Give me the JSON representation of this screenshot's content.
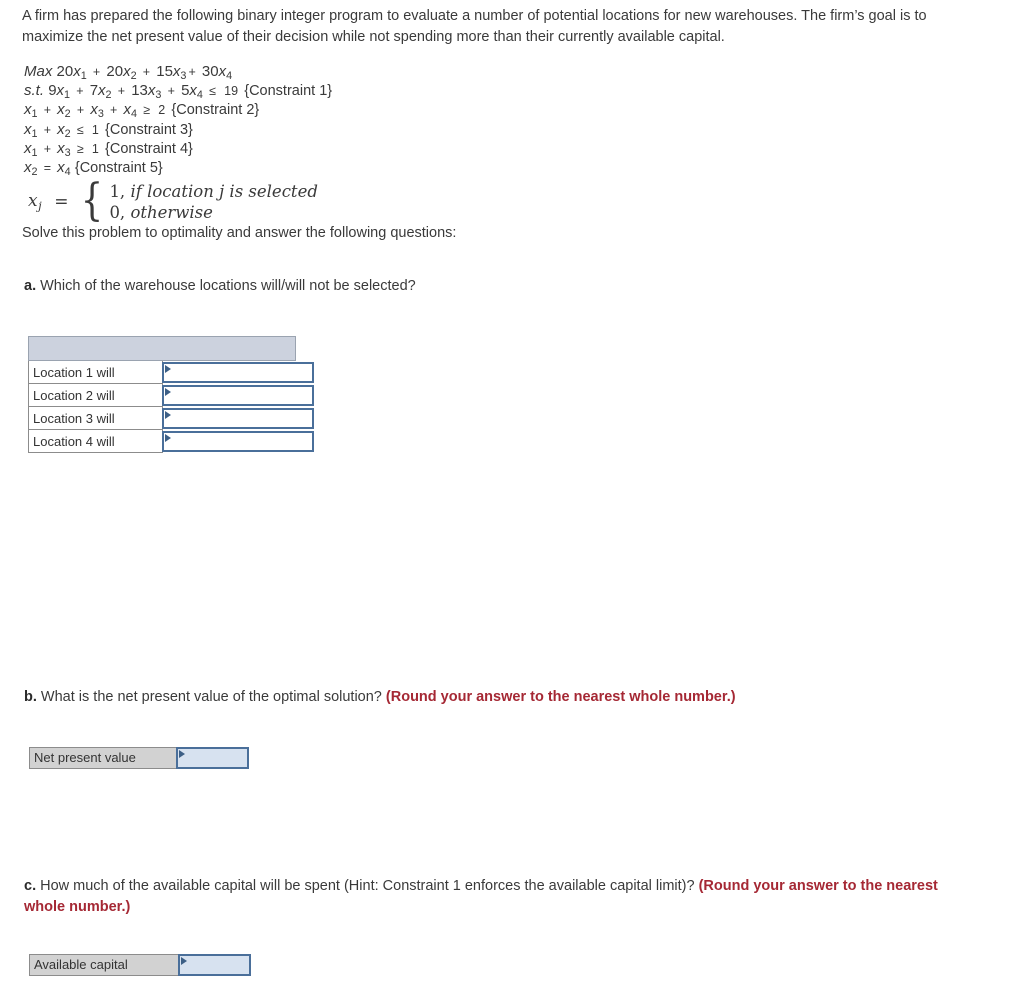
{
  "intro": {
    "paragraph": "A firm has prepared the following binary integer program to evaluate a number of potential locations for new warehouses. The firm’s goal is to maximize the net present value of their decision while not spending more than their currently available capital."
  },
  "model": {
    "objective": {
      "keyword": "Max",
      "terms": [
        {
          "coef": "20",
          "var": "x",
          "sub": "1",
          "op": ""
        },
        {
          "coef": "20",
          "var": "x",
          "sub": "2",
          "op": "+"
        },
        {
          "coef": "15",
          "var": "x",
          "sub": "3",
          "op": "+"
        },
        {
          "coef": "30",
          "var": "x",
          "sub": "4",
          "op": "+"
        }
      ]
    },
    "constraints": [
      {
        "keyword": "s.t.",
        "terms": [
          {
            "coef": "9",
            "var": "x",
            "sub": "1",
            "op": ""
          },
          {
            "coef": "7",
            "var": "x",
            "sub": "2",
            "op": "+"
          },
          {
            "coef": "13",
            "var": "x",
            "sub": "3",
            "op": "+"
          },
          {
            "coef": "5",
            "var": "x",
            "sub": "4",
            "op": "+"
          }
        ],
        "relation": "≤",
        "rhs": "19",
        "tag": "{Constraint 1}"
      },
      {
        "keyword": "",
        "terms": [
          {
            "coef": "",
            "var": "x",
            "sub": "1",
            "op": ""
          },
          {
            "coef": "",
            "var": "x",
            "sub": "2",
            "op": "+"
          },
          {
            "coef": "",
            "var": "x",
            "sub": "3",
            "op": "+"
          },
          {
            "coef": "",
            "var": "x",
            "sub": "4",
            "op": "+"
          }
        ],
        "relation": "≥",
        "rhs": "2",
        "tag": "{Constraint 2}"
      },
      {
        "keyword": "",
        "terms": [
          {
            "coef": "",
            "var": "x",
            "sub": "1",
            "op": ""
          },
          {
            "coef": "",
            "var": "x",
            "sub": "2",
            "op": "+"
          }
        ],
        "relation": "≤",
        "rhs": "1",
        "tag": "{Constraint 3}"
      },
      {
        "keyword": "",
        "terms": [
          {
            "coef": "",
            "var": "x",
            "sub": "1",
            "op": ""
          },
          {
            "coef": "",
            "var": "x",
            "sub": "3",
            "op": "+"
          }
        ],
        "relation": "≥",
        "rhs": "1",
        "tag": "{Constraint 4}"
      },
      {
        "keyword": "",
        "terms": [
          {
            "coef": "",
            "var": "x",
            "sub": "2",
            "op": ""
          },
          {
            "coef": "",
            "var": "x",
            "sub": "4",
            "op": "="
          }
        ],
        "relation": "",
        "rhs": "",
        "tag": "{Constraint 5}"
      }
    ],
    "definition": {
      "lhs_var": "x",
      "lhs_sub": "j",
      "equals": "=",
      "case_1_value": "1,",
      "case_1_text": "if location j is selected",
      "case_0_value": "0,",
      "case_0_text": "otherwise"
    },
    "solve_line": "Solve this problem to optimality and answer the following questions:"
  },
  "part_a": {
    "label": "a.",
    "question": "Which of the warehouse locations will/will not be selected?",
    "table": {
      "header_text": "",
      "rows": [
        {
          "label": "Location 1 will",
          "value": ""
        },
        {
          "label": "Location 2 will",
          "value": ""
        },
        {
          "label": "Location 3 will",
          "value": ""
        },
        {
          "label": "Location 4 will",
          "value": ""
        }
      ]
    }
  },
  "part_b": {
    "label": "b.",
    "question": "What is the net present value of the optimal solution?",
    "note": "(Round your answer to the nearest whole number.)",
    "answer": {
      "label": "Net present value",
      "value": ""
    }
  },
  "part_c": {
    "label": "c.",
    "question": "How much of the available capital will be spent (Hint: Constraint 1 enforces the available capital limit)?",
    "note": "(Round your answer to the nearest whole number.)",
    "answer": {
      "label": "Available capital",
      "value": ""
    }
  },
  "colors": {
    "text": "#3a3a3a",
    "red_note": "#a52834",
    "table_header_fill": "#ccd2de",
    "input_border": "#4a6f9a",
    "input_fill": "#d7e2f0",
    "label_fill": "#d2d2d2"
  }
}
